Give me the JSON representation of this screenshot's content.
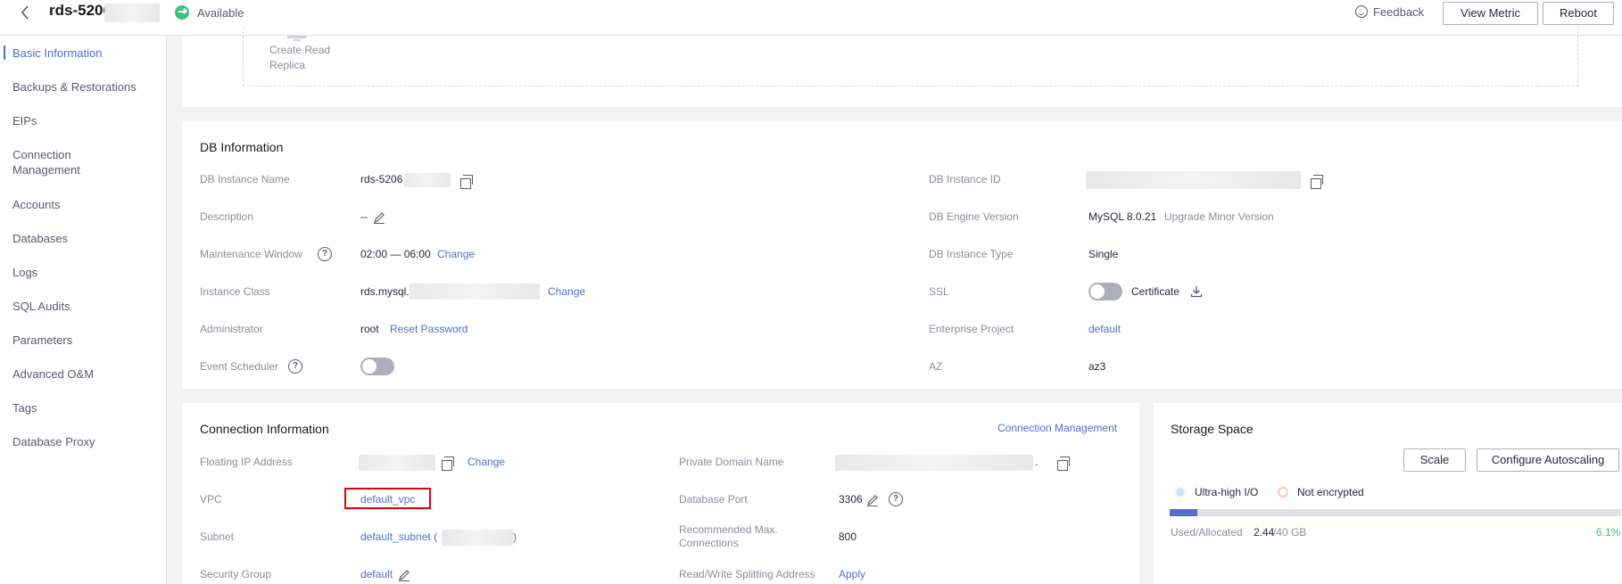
{
  "header": {
    "back_icon": "chevron-left-icon",
    "title": "rds-5206",
    "status": "Available",
    "feedback": "Feedback",
    "view_metric": "View Metric",
    "reboot": "Reboot"
  },
  "sidebar": {
    "items": [
      {
        "label": "Basic Information",
        "active": true
      },
      {
        "label": "Backups & Restorations"
      },
      {
        "label": "EIPs"
      },
      {
        "label": "Connection Management"
      },
      {
        "label": "Accounts"
      },
      {
        "label": "Databases"
      },
      {
        "label": "Logs"
      },
      {
        "label": "SQL Audits"
      },
      {
        "label": "Parameters"
      },
      {
        "label": "Advanced O&M"
      },
      {
        "label": "Tags"
      },
      {
        "label": "Database Proxy"
      }
    ]
  },
  "replica": {
    "label_line1": "Create Read",
    "label_line2": "Replica"
  },
  "db_info": {
    "title": "DB Information",
    "instance_name_label": "DB Instance Name",
    "instance_name_value": "rds-5206",
    "description_label": "Description",
    "description_value": "--",
    "maintenance_label": "Maintenance Window",
    "maintenance_value": "02:00 — 06:00",
    "maintenance_change": "Change",
    "instance_class_label": "Instance Class",
    "instance_class_value": "rds.mysql.",
    "instance_class_change": "Change",
    "administrator_label": "Administrator",
    "administrator_value": "root",
    "reset_password": "Reset Password",
    "event_scheduler_label": "Event Scheduler",
    "event_scheduler_on": false,
    "instance_id_label": "DB Instance ID",
    "engine_label": "DB Engine Version",
    "engine_value": "MySQL 8.0.21",
    "upgrade_minor": "Upgrade Minor Version",
    "type_label": "DB Instance Type",
    "type_value": "Single",
    "ssl_label": "SSL",
    "ssl_on": false,
    "certificate": "Certificate",
    "enterprise_label": "Enterprise Project",
    "enterprise_value": "default",
    "az_label": "AZ",
    "az_value": "az3"
  },
  "connection": {
    "title": "Connection Information",
    "manage_link": "Connection Management",
    "floating_ip_label": "Floating IP Address",
    "floating_ip_change": "Change",
    "vpc_label": "VPC",
    "vpc_value": "default_vpc",
    "subnet_label": "Subnet",
    "subnet_value": "default_subnet (",
    "subnet_close": ")",
    "security_group_label": "Security Group",
    "security_group_value": "default",
    "private_domain_label": "Private Domain Name",
    "private_domain_suffix": ".",
    "port_label": "Database Port",
    "port_value": "3306",
    "max_conn_label": "Recommended Max. Connections",
    "max_conn_value": "800",
    "rw_split_label": "Read/Write Splitting Address",
    "rw_split_value": "Apply"
  },
  "storage": {
    "title": "Storage Space",
    "scale": "Scale",
    "autoscale": "Configure Autoscaling",
    "legend_io": "Ultra-high I/O",
    "legend_encrypt": "Not encrypted",
    "used_label": "Used/Allocated",
    "used_value": "2.44",
    "allocated_value": "/40 GB",
    "percent": "6.1%",
    "usage_fraction": 0.061
  },
  "colors": {
    "accent": "#526ecc",
    "available": "#3dbf7e",
    "highlight": "#e0000a",
    "percent": "#3dbf7e"
  }
}
